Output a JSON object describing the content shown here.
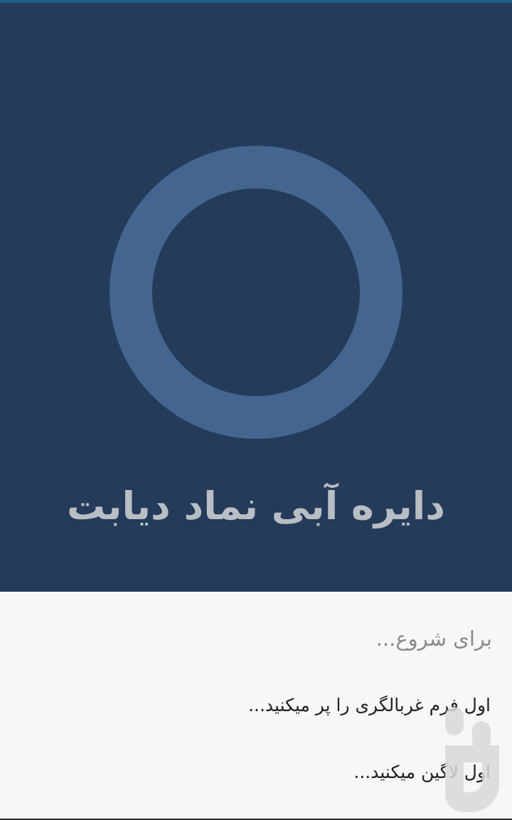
{
  "colors": {
    "top_strip": "#1c5e8a",
    "hero_background": "#243b5a",
    "ring": "#44658f",
    "hero_text": "#b9bdc4",
    "sheet_background": "#f7f7f7",
    "sheet_heading": "#8a8a8a",
    "option_text": "#222222"
  },
  "hero": {
    "title": "دایره آبی نماد دیابت",
    "ring_icon": "blue-circle-ring"
  },
  "sheet": {
    "heading": "برای شروع...",
    "options": [
      {
        "label": "اول فرم غربالگری را پر میکنید..."
      },
      {
        "label": "اول لاگین میکنید..."
      }
    ]
  },
  "watermark": {
    "icon": "bazaar-logo"
  }
}
